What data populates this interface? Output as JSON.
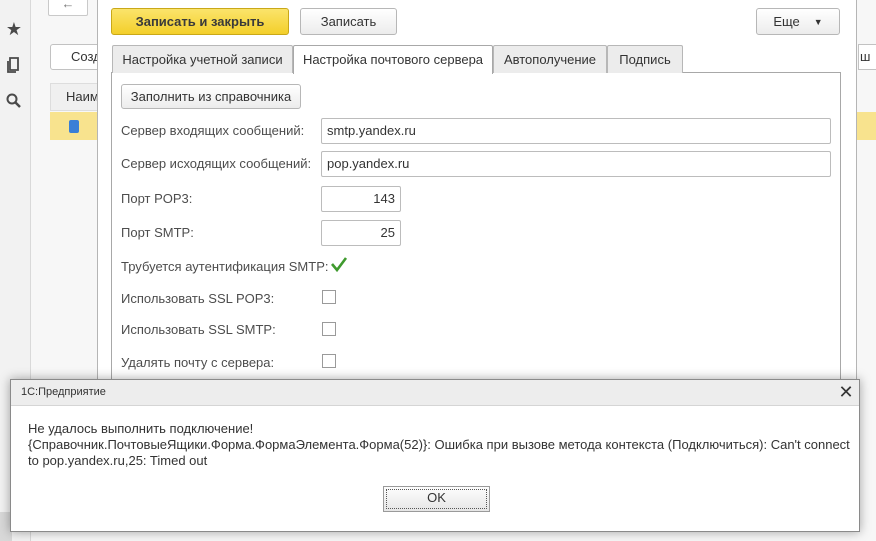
{
  "background": {
    "nav_icons": [
      "star-icon",
      "history-icon",
      "search-icon"
    ],
    "back_arrow": "←",
    "create_label": "Созд",
    "table_header": "Наим",
    "right_fragment": "ш"
  },
  "form": {
    "toolbar": {
      "save_close_label": "Записать и закрыть",
      "save_label": "Записать",
      "more_label": "Еще"
    },
    "tabs": [
      {
        "label": "Настройка учетной записи",
        "active": false
      },
      {
        "label": "Настройка почтового сервера",
        "active": true
      },
      {
        "label": "Автополучение",
        "active": false
      },
      {
        "label": "Подпись",
        "active": false
      }
    ],
    "fill_from_catalog_label": "Заполнить из справочника",
    "fields": {
      "incoming_server": {
        "label": "Сервер входящих сообщений:",
        "value": "smtp.yandex.ru"
      },
      "outgoing_server": {
        "label": "Сервер исходящих сообщений:",
        "value": "pop.yandex.ru"
      },
      "pop3_port": {
        "label": "Порт POP3:",
        "value": "143"
      },
      "smtp_port": {
        "label": "Порт SMTP:",
        "value": "25"
      },
      "smtp_auth": {
        "label": "Трубуется аутентификация SMTP:",
        "checked": true
      },
      "ssl_pop3": {
        "label": "Использовать SSL POP3:",
        "checked": false
      },
      "ssl_smtp": {
        "label": "Использовать SSL SMTP:",
        "checked": false
      },
      "delete_from_server": {
        "label": "Удалять почту с сервера:",
        "checked": false
      }
    },
    "colors": {
      "primary_button": "#f3cf2a",
      "selected_row": "#f8e38e",
      "check_green": "#3f9a2e"
    }
  },
  "dialog": {
    "title": "1С:Предприятие",
    "line1": "Не удалось выполнить подключение!",
    "line2": "{Справочник.ПочтовыеЯщики.Форма.ФормаЭлемента.Форма(52)}: Ошибка при вызове метода контекста (Подключиться): Can't connect to pop.yandex.ru,25: Timed out",
    "ok_label": "OK",
    "close_icon": "close-icon"
  }
}
